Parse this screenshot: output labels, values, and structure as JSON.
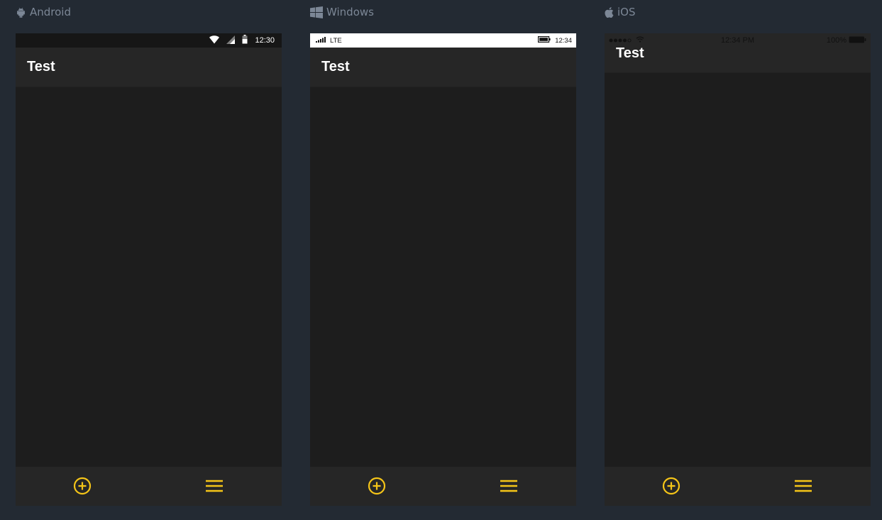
{
  "platforms": [
    {
      "label": "Android",
      "icon": "android-icon",
      "status": {
        "time": "12:30",
        "icons": [
          "wifi-icon",
          "cell-signal-icon",
          "battery-icon"
        ]
      },
      "app_title": "Test",
      "bottom_icons": [
        "add-circle-icon",
        "hamburger-menu-icon"
      ]
    },
    {
      "label": "Windows",
      "icon": "windows-logo-icon",
      "status": {
        "network": "LTE",
        "time": "12:34",
        "icons": [
          "signal-bars-icon",
          "battery-icon"
        ]
      },
      "app_title": "Test",
      "bottom_icons": [
        "add-circle-icon",
        "hamburger-menu-icon"
      ]
    },
    {
      "label": "iOS",
      "icon": "apple-icon",
      "status": {
        "time": "12:34 PM",
        "battery": "100%",
        "icons": [
          "signal-dots-icon",
          "wifi-icon",
          "battery-icon"
        ]
      },
      "app_title": "Test",
      "bottom_icons": [
        "add-circle-icon",
        "hamburger-menu-icon"
      ]
    }
  ],
  "colors": {
    "page_background": "#232a33",
    "app_background": "#1d1d1d",
    "header_background": "#262626",
    "accent": "#f5c518",
    "label": "#7c8796"
  }
}
